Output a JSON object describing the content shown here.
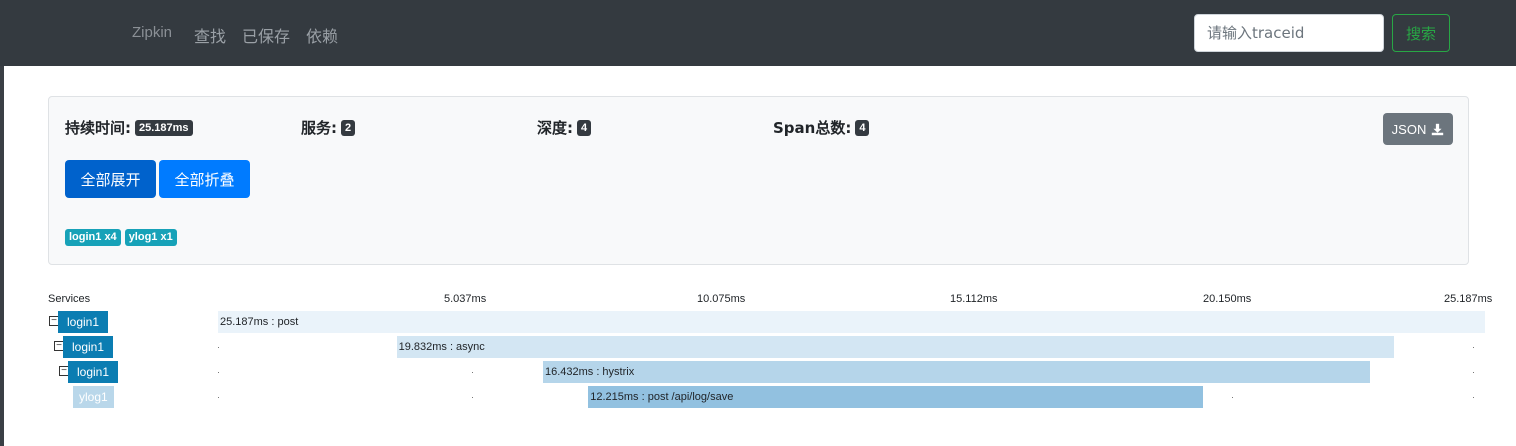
{
  "navbar": {
    "brand": "Zipkin",
    "links": [
      "查找",
      "已保存",
      "依赖"
    ],
    "search_placeholder": "请输入traceid",
    "search_button": "搜索"
  },
  "summary": {
    "duration_label": "持续时间:",
    "duration_value": "25.187ms",
    "services_label": "服务:",
    "services_value": "2",
    "depth_label": "深度:",
    "depth_value": "4",
    "spans_label": "Span总数:",
    "spans_value": "4",
    "json_button": "JSON",
    "expand_all": "全部展开",
    "collapse_all": "全部折叠",
    "service_badges": [
      "login1 x4",
      "ylog1 x1"
    ]
  },
  "timeline": {
    "services_header": "Services",
    "ticks": [
      "5.037ms",
      "10.075ms",
      "15.112ms",
      "20.150ms",
      "25.187ms"
    ],
    "rows": [
      {
        "service": "login1",
        "label": "25.187ms : post",
        "start_ms": 0,
        "duration_ms": 25.187,
        "collapsible": true
      },
      {
        "service": "login1",
        "label": "19.832ms : async",
        "start_ms": 3.55,
        "duration_ms": 19.832,
        "collapsible": true
      },
      {
        "service": "login1",
        "label": "16.432ms : hystrix",
        "start_ms": 6.46,
        "duration_ms": 16.432,
        "collapsible": true
      },
      {
        "service": "ylog1",
        "label": "12.215ms : post /api/log/save",
        "start_ms": 7.36,
        "duration_ms": 12.215,
        "collapsible": false
      }
    ]
  },
  "colors": {
    "navbar": "#343a40",
    "service_login1": "#0b7db2",
    "service_ylog1": "#b9d7ea",
    "row_bg": "#eaf3fa",
    "bar_levels": [
      "#eaf3fa",
      "#d3e6f3",
      "#b5d5ea",
      "#92c1e0"
    ]
  }
}
